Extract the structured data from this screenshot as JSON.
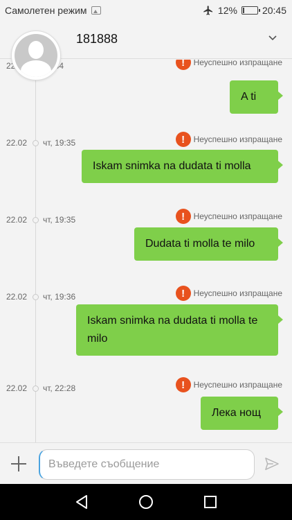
{
  "status_bar": {
    "left_text": "Самолетен режим",
    "battery_text": "12%",
    "battery_level": 0.12,
    "time": "20:45"
  },
  "header": {
    "contact_name": "181888"
  },
  "messages": [
    {
      "date": "22.02",
      "time": "19:34",
      "status": "Неуспешно изпращане",
      "text": "A ti"
    },
    {
      "date": "22.02",
      "time": "чт, 19:35",
      "status": "Неуспешно изпращане",
      "text": "Iskam snimka na dudata ti molla"
    },
    {
      "date": "22.02",
      "time": "чт, 19:35",
      "status": "Неуспешно изпращане",
      "text": "Dudata ti molla te milo"
    },
    {
      "date": "22.02",
      "time": "чт, 19:36",
      "status": "Неуспешно изпращане",
      "text": "Iskam snimka na dudata ti molla te milo"
    },
    {
      "date": "22.02",
      "time": "чт, 22:28",
      "status": "Неуспешно изпращане",
      "text": "Лека нощ"
    }
  ],
  "compose": {
    "placeholder": "Въведете съобщение",
    "value": ""
  },
  "colors": {
    "bubble": "#7fcf4a",
    "error": "#e8521e",
    "background": "#f3f3f3"
  },
  "icons": {
    "fail": "exclamation-icon",
    "attach": "plus-icon",
    "send": "send-icon",
    "back": "back-triangle-icon",
    "home": "home-circle-icon",
    "recents": "recents-square-icon"
  }
}
